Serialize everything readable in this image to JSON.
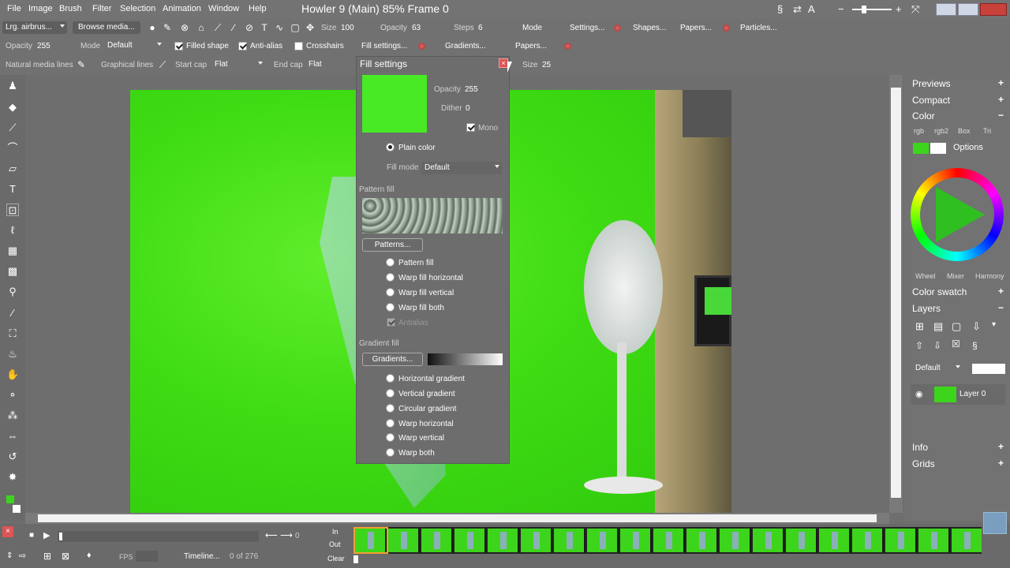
{
  "menubar": {
    "items": [
      "File",
      "Image",
      "Brush",
      "Filter",
      "Selection",
      "Animation",
      "Window",
      "Help"
    ],
    "title": "Howler 9 (Main)  85%  Frame 0"
  },
  "toolbar1": {
    "brush_preset": "Lrg. airbrus...",
    "browse_media": "Browse media...",
    "size_label": "Size",
    "size_value": "100",
    "opacity_label": "Opacity",
    "opacity_value": "63",
    "steps_label": "Steps",
    "steps_value": "6",
    "mode": "Mode",
    "settings": "Settings...",
    "shapes": "Shapes...",
    "papers": "Papers...",
    "particles": "Particles..."
  },
  "toolbar2": {
    "opacity_label": "Opacity",
    "opacity_value": "255",
    "mode_label": "Mode",
    "mode_value": "Default",
    "filled_shape": "Filled shape",
    "anti_alias": "Anti-alias",
    "crosshairs": "Crosshairs",
    "fill_settings": "Fill settings...",
    "gradients": "Gradients...",
    "papers": "Papers..."
  },
  "toolbar3": {
    "natural_media_lines": "Natural media lines",
    "graphical_lines": "Graphical lines",
    "start_cap_label": "Start cap",
    "start_cap_value": "Flat",
    "end_cap_label": "End cap",
    "end_cap_value": "Flat",
    "size_label": "Size",
    "size_value": "25"
  },
  "fill_dialog": {
    "title": "Fill settings",
    "opacity_label": "Opacity",
    "opacity_value": "255",
    "dither_label": "Dither",
    "dither_value": "0",
    "mono": "Mono",
    "plain_color": "Plain color",
    "fill_mode_label": "Fill mode",
    "fill_mode_value": "Default",
    "pattern_section": "Pattern fill",
    "patterns_button": "Patterns...",
    "pattern_options": [
      "Pattern fill",
      "Warp fill horizontal",
      "Warp fill vertical",
      "Warp fill both"
    ],
    "antialias": "Antialias",
    "gradient_section": "Gradient fill",
    "gradients_button": "Gradients...",
    "gradient_options": [
      "Horizontal gradient",
      "Vertical gradient",
      "Circular gradient",
      "Warp horizontal",
      "Warp vertical",
      "Warp both"
    ],
    "swatch_color": "#47ea24"
  },
  "right_panel": {
    "previews": "Previews",
    "compact": "Compact",
    "color": "Color",
    "color_tabs": [
      "rgb",
      "rgb2",
      "Box",
      "Tri"
    ],
    "options": "Options",
    "wheel_tabs": [
      "Wheel",
      "Mixer",
      "Harmony"
    ],
    "color_swatch": "Color swatch",
    "layers": "Layers",
    "layer_mode": "Default",
    "layer_name": "Layer 0",
    "info": "Info",
    "grids": "Grids"
  },
  "timeline": {
    "frame_readout": "0",
    "in_label": "In",
    "out_label": "Out",
    "clear_label": "Clear",
    "fps_label": "FPS",
    "timeline_button": "Timeline...",
    "frame_count": "0 of 276"
  }
}
